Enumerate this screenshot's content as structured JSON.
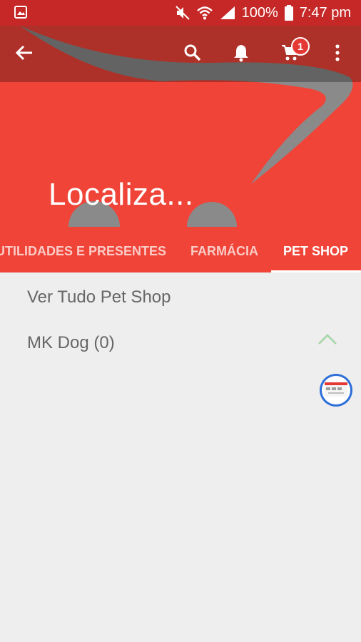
{
  "status_bar": {
    "battery_text": "100%",
    "time": "7:47 pm",
    "icons": [
      "gallery-icon",
      "vibrate-off-icon",
      "wifi-icon",
      "signal-icon",
      "battery-icon"
    ]
  },
  "toolbar": {
    "title": "Localiza...",
    "cart_badge": "1",
    "icons": [
      "back-arrow-icon",
      "search-icon",
      "bell-icon",
      "cart-icon",
      "more-vertical-icon"
    ]
  },
  "tabs": [
    {
      "label": "UTILIDADES E PRESENTES",
      "active": false
    },
    {
      "label": "FARMÁCIA",
      "active": false
    },
    {
      "label": "PET SHOP",
      "active": true
    }
  ],
  "list": {
    "items": [
      {
        "label": "Ver Tudo Pet Shop"
      },
      {
        "label": "MK Dog (0)"
      }
    ]
  },
  "colors": {
    "status_bar": "#c62828",
    "header": "#f04438",
    "accent_chevron": "#a5d6a7",
    "background": "#eeeeee"
  }
}
